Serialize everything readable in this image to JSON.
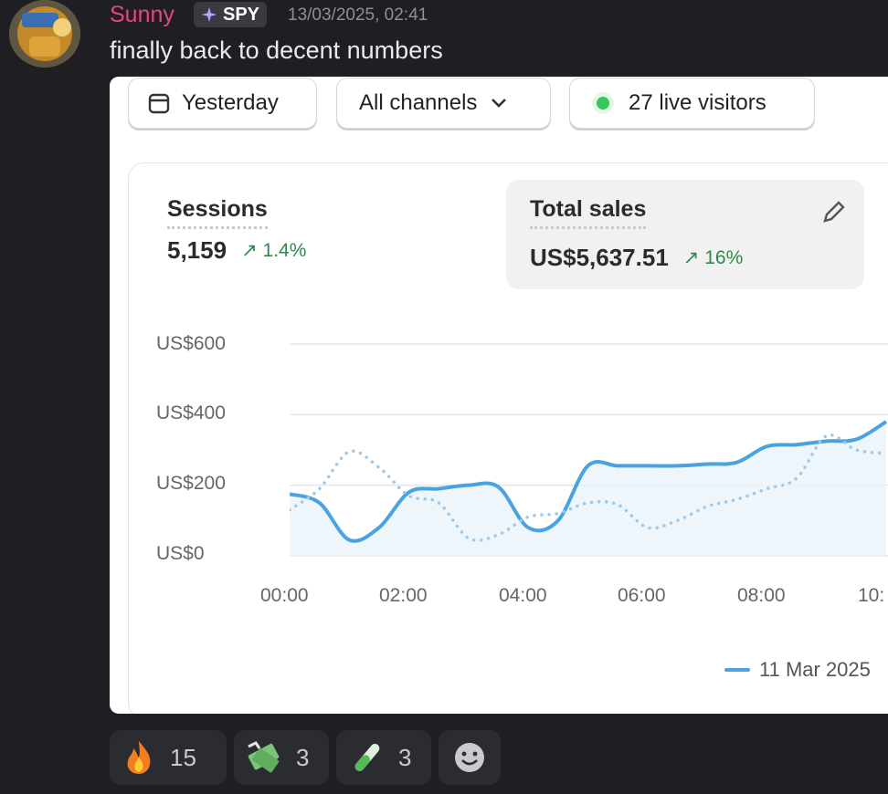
{
  "message": {
    "author": "Sunny",
    "tag": "SPY",
    "timestamp": "13/03/2025, 02:41",
    "text": "finally back to decent numbers"
  },
  "dashboard": {
    "date_filter": "Yesterday",
    "channel_filter": "All channels",
    "live_visitors": "27 live visitors",
    "sessions": {
      "label": "Sessions",
      "value": "5,159",
      "change": "1.4%"
    },
    "total_sales": {
      "label": "Total sales",
      "value": "US$5,637.51",
      "change": "16%"
    },
    "legend": "11 Mar 2025"
  },
  "chart_data": {
    "type": "line",
    "y_ticks": [
      "US$600",
      "US$400",
      "US$200",
      "US$0"
    ],
    "x_ticks": [
      "00:00",
      "02:00",
      "04:00",
      "06:00",
      "08:00",
      "10:"
    ],
    "ylim": [
      0,
      600
    ],
    "series": [
      {
        "name": "",
        "style": "solid",
        "color": "#4aa3df",
        "x": [
          0,
          0.5,
          1,
          1.5,
          2,
          2.5,
          3,
          3.5,
          4,
          4.5,
          5,
          5.5,
          6,
          6.5,
          7,
          7.5,
          8,
          8.5,
          9,
          9.5,
          10
        ],
        "values": [
          175,
          150,
          45,
          80,
          180,
          190,
          200,
          195,
          80,
          100,
          255,
          255,
          255,
          255,
          260,
          265,
          310,
          315,
          325,
          330,
          380
        ]
      },
      {
        "name": "11 Mar 2025",
        "style": "dotted",
        "color": "#9cc9ec",
        "x": [
          0,
          0.5,
          1,
          1.5,
          2,
          2.5,
          3,
          3.5,
          4,
          4.5,
          5,
          5.5,
          6,
          6.5,
          7,
          7.5,
          8,
          8.5,
          9,
          9.5,
          10
        ],
        "values": [
          130,
          190,
          295,
          250,
          170,
          150,
          50,
          60,
          110,
          120,
          150,
          145,
          80,
          100,
          140,
          160,
          190,
          220,
          340,
          300,
          290
        ]
      }
    ]
  },
  "reactions": [
    {
      "icon": "fire-emoji-icon",
      "count": "15"
    },
    {
      "icon": "money-emoji-icon",
      "count": "3"
    },
    {
      "icon": "test-tube-emoji-icon",
      "count": "3"
    },
    {
      "icon": "add-reaction-icon",
      "count": ""
    }
  ],
  "colors": {
    "accent": "#4aa3df",
    "positive": "#2e8b4a",
    "author": "#e8447d"
  }
}
